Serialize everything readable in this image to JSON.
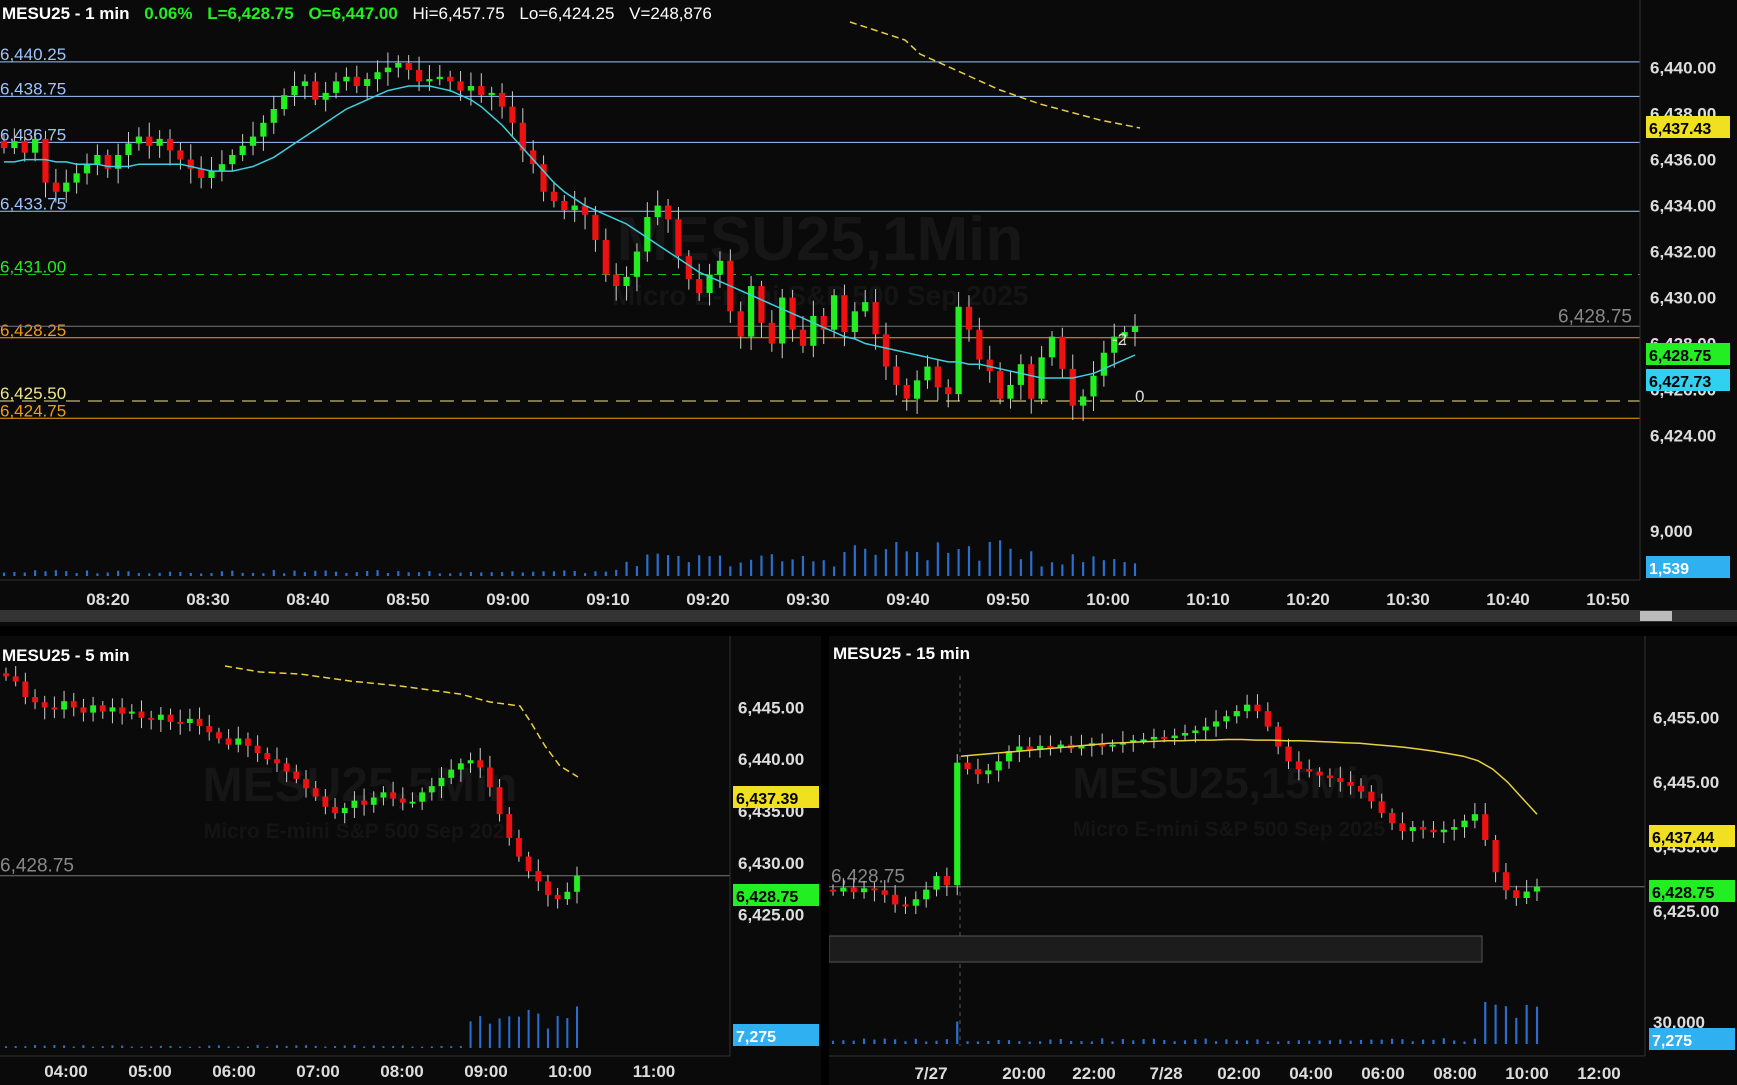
{
  "colors": {
    "up": "#22ee22",
    "down": "#ee1111",
    "ma": "#3fd0e0",
    "ma_yellow": "#e8d040",
    "grid": "#9ec4ff",
    "green_line": "#1ebd1e",
    "orange": "#f39c12",
    "yellow_line": "#f0e68c",
    "bg": "#0a0a0a",
    "vol": "#2a6fd0"
  },
  "top": {
    "header": {
      "symbol": "MESU25 - 1 min",
      "change": "0.06%",
      "last": "L=6,428.75",
      "open": "O=6,447.00",
      "high": "Hi=6,457.75",
      "low": "Lo=6,424.25",
      "volume": "V=248,876"
    },
    "watermark": {
      "title": "MESU25,1Min",
      "subtitle": "Micro E-mini S&P 500 Sep 2025"
    },
    "tags": {
      "ma_value": "6,437.43",
      "last_price": "6,428.75",
      "ma_cyan": "6,427.73",
      "volume": "1,539",
      "price_label": "6,428.75",
      "pos_minus": "-2",
      "pos_zero": "0"
    }
  },
  "bottom_left": {
    "header": "MESU25 - 5 min",
    "watermark": {
      "title": "MESU25,5Min",
      "subtitle": "Micro E-mini S&P 500 Sep 2025"
    },
    "tags": {
      "ma_value": "6,437.39",
      "last_price": "6,428.75",
      "volume": "7,275",
      "price_label": "6,428.75"
    }
  },
  "bottom_right": {
    "header": "MESU25 - 15 min",
    "watermark": {
      "title": "MESU25,15Min",
      "subtitle": "Micro E-mini S&P 500 Sep 2025"
    },
    "tags": {
      "ma_value": "6,437.44",
      "last_price": "6,428.75",
      "volume": "7,275",
      "price_label": "6,428.75"
    }
  },
  "chart_data": [
    {
      "type": "candlestick",
      "title": "MESU25 - 1 min",
      "ylim": [
        6422.5,
        6441.2
      ],
      "y_ticks": [
        "6,440.00",
        "6,438.00",
        "6,436.00",
        "6,434.00",
        "6,432.00",
        "6,430.00",
        "6,428.00",
        "6,426.00",
        "6,424.00"
      ],
      "x_ticks": [
        "08:20",
        "08:30",
        "08:40",
        "08:50",
        "09:00",
        "09:10",
        "09:20",
        "09:30",
        "09:40",
        "09:50",
        "10:00",
        "10:10",
        "10:20",
        "10:30",
        "10:40",
        "10:50"
      ],
      "volume_ticks": [
        "9,000"
      ],
      "levels": [
        {
          "value": 6440.25,
          "label": "6,440.25",
          "style": "grid"
        },
        {
          "value": 6438.75,
          "label": "6,438.75",
          "style": "grid"
        },
        {
          "value": 6436.75,
          "label": "6,436.75",
          "style": "grid"
        },
        {
          "value": 6433.75,
          "label": "6,433.75",
          "style": "grid"
        },
        {
          "value": 6431.0,
          "label": "6,431.00",
          "style": "green"
        },
        {
          "value": 6428.25,
          "label": "6,428.25",
          "style": "orange"
        },
        {
          "value": 6425.5,
          "label": "6,425.50",
          "style": "yellow"
        },
        {
          "value": 6424.75,
          "label": "6,424.75",
          "style": "orange"
        }
      ],
      "last_price": 6428.75,
      "closes": [
        6436.5,
        6436.8,
        6436.3,
        6436.9,
        6435.0,
        6434.6,
        6435.0,
        6435.4,
        6435.8,
        6436.2,
        6435.6,
        6436.2,
        6436.7,
        6437.0,
        6436.6,
        6436.9,
        6436.4,
        6436.0,
        6435.6,
        6435.2,
        6435.5,
        6435.8,
        6436.2,
        6436.6,
        6437.0,
        6437.6,
        6438.2,
        6438.8,
        6439.2,
        6439.4,
        6438.6,
        6438.9,
        6439.4,
        6439.6,
        6439.2,
        6439.5,
        6439.8,
        6440.0,
        6440.2,
        6439.9,
        6439.4,
        6439.5,
        6439.6,
        6439.4,
        6439.0,
        6439.2,
        6438.8,
        6438.9,
        6438.3,
        6437.6,
        6436.4,
        6435.8,
        6434.6,
        6434.2,
        6433.8,
        6434.0,
        6433.6,
        6432.5,
        6431.0,
        6430.5,
        6430.9,
        6432.0,
        6433.5,
        6434.0,
        6433.4,
        6431.8,
        6430.8,
        6430.2,
        6431.0,
        6431.6,
        6429.4,
        6428.3,
        6430.5,
        6428.9,
        6428.0,
        6430.0,
        6428.6,
        6427.9,
        6429.2,
        6428.6,
        6430.1,
        6428.5,
        6429.4,
        6429.8,
        6428.4,
        6427.0,
        6426.2,
        6425.6,
        6426.4,
        6427.0,
        6426.1,
        6425.8,
        6429.6,
        6428.6,
        6427.3,
        6426.8,
        6425.6,
        6426.2,
        6427.1,
        6425.6,
        6427.4,
        6428.3,
        6426.9,
        6425.3,
        6425.7,
        6426.6,
        6427.6,
        6428.3,
        6428.5,
        6428.75
      ],
      "ma": [
        6435.9,
        6435.9,
        6436.0,
        6436.0,
        6436.0,
        6435.9,
        6435.9,
        6435.8,
        6435.8,
        6435.8,
        6435.7,
        6435.7,
        6435.7,
        6435.8,
        6435.8,
        6435.8,
        6435.8,
        6435.8,
        6435.7,
        6435.6,
        6435.5,
        6435.5,
        6435.5,
        6435.6,
        6435.7,
        6435.9,
        6436.1,
        6436.4,
        6436.7,
        6437.0,
        6437.3,
        6437.6,
        6437.9,
        6438.2,
        6438.4,
        6438.6,
        6438.8,
        6439.0,
        6439.1,
        6439.2,
        6439.2,
        6439.2,
        6439.1,
        6439.0,
        6438.8,
        6438.6,
        6438.3,
        6437.9,
        6437.5,
        6437.0,
        6436.5,
        6436.0,
        6435.5,
        6435.0,
        6434.6,
        6434.3,
        6434.0,
        6433.8,
        6433.6,
        6433.4,
        6433.2,
        6432.9,
        6432.6,
        6432.3,
        6432.0,
        6431.7,
        6431.4,
        6431.1,
        6430.9,
        6430.7,
        6430.5,
        6430.3,
        6430.1,
        6429.9,
        6429.7,
        6429.5,
        6429.3,
        6429.1,
        6428.9,
        6428.7,
        6428.5,
        6428.3,
        6428.2,
        6428.0,
        6427.9,
        6427.8,
        6427.7,
        6427.6,
        6427.5,
        6427.4,
        6427.3,
        6427.2,
        6427.2,
        6427.1,
        6427.1,
        6427.0,
        6426.9,
        6426.8,
        6426.7,
        6426.6,
        6426.5,
        6426.5,
        6426.5,
        6426.5,
        6426.6,
        6426.7,
        6426.9,
        6427.1,
        6427.3,
        6427.5
      ]
    },
    {
      "type": "candlestick",
      "title": "MESU25 - 5 min",
      "ylim": [
        6421.0,
        6449.0
      ],
      "y_ticks": [
        "6,445.00",
        "6,440.00",
        "6,435.00",
        "6,430.00",
        "6,425.00"
      ],
      "x_ticks": [
        "04:00",
        "05:00",
        "06:00",
        "07:00",
        "08:00",
        "09:00",
        "10:00",
        "11:00"
      ],
      "closes": [
        6448.0,
        6447.5,
        6446.0,
        6445.5,
        6445.0,
        6444.8,
        6445.6,
        6445.0,
        6444.5,
        6445.2,
        6444.6,
        6445.0,
        6444.4,
        6444.6,
        6444.0,
        6443.8,
        6444.3,
        6443.6,
        6443.5,
        6443.9,
        6443.2,
        6442.6,
        6442.0,
        6441.4,
        6442.0,
        6441.3,
        6440.6,
        6440.0,
        6439.6,
        6438.8,
        6438.1,
        6437.2,
        6436.4,
        6435.4,
        6434.8,
        6435.3,
        6436.0,
        6435.6,
        6436.3,
        6436.8,
        6436.2,
        6435.8,
        6435.9,
        6436.8,
        6437.4,
        6438.2,
        6439.0,
        6439.6,
        6439.9,
        6439.2,
        6437.3,
        6434.7,
        6432.4,
        6430.6,
        6429.2,
        6428.2,
        6426.9,
        6426.5,
        6427.2,
        6428.75
      ]
    },
    {
      "type": "candlestick",
      "title": "MESU25 - 15 min",
      "ylim": [
        6418.0,
        6463.0
      ],
      "y_ticks": [
        "6,455.00",
        "6,445.00",
        "6,435.00",
        "6,425.00"
      ],
      "x_ticks": [
        "7/27",
        "20:00",
        "22:00",
        "7/28",
        "02:00",
        "04:00",
        "06:00",
        "08:00",
        "10:00",
        "12:00"
      ],
      "volume_ticks": [
        "30,000"
      ],
      "closes": [
        6428.0,
        6428.6,
        6427.9,
        6428.5,
        6428.2,
        6427.5,
        6426.0,
        6425.8,
        6426.8,
        6428.3,
        6430.4,
        6429.0,
        6448.0,
        6447.0,
        6446.2,
        6446.8,
        6448.2,
        6449.8,
        6450.5,
        6450.0,
        6450.6,
        6450.3,
        6450.8,
        6450.2,
        6450.6,
        6451.0,
        6450.5,
        6450.8,
        6451.2,
        6451.5,
        6451.6,
        6452.0,
        6451.8,
        6452.2,
        6452.6,
        6453.0,
        6453.6,
        6454.4,
        6455.2,
        6456.0,
        6457.0,
        6456.0,
        6453.6,
        6450.5,
        6448.2,
        6447.0,
        6446.6,
        6446.0,
        6445.6,
        6445.0,
        6444.4,
        6443.5,
        6442.0,
        6440.2,
        6438.6,
        6437.4,
        6438.0,
        6437.6,
        6437.2,
        6437.6,
        6438.0,
        6439.0,
        6440.0,
        6436.0,
        6431.0,
        6428.2,
        6427.0,
        6428.0,
        6428.75
      ],
      "ma": [
        6449.0,
        6449.2,
        6449.4,
        6449.6,
        6449.8,
        6450.0,
        6450.2,
        6450.4,
        6450.6,
        6450.8,
        6451.0,
        6451.1,
        6451.2,
        6451.3,
        6451.4,
        6451.4,
        6451.5,
        6451.5,
        6451.6,
        6451.6,
        6451.5,
        6451.5,
        6451.4,
        6451.4,
        6451.3,
        6451.2,
        6451.1,
        6451.0,
        6450.8,
        6450.6,
        6450.4,
        6450.1,
        6449.8,
        6449.4,
        6449.0,
        6448.3,
        6447.0,
        6445.0,
        6442.5,
        6440.0
      ]
    }
  ]
}
